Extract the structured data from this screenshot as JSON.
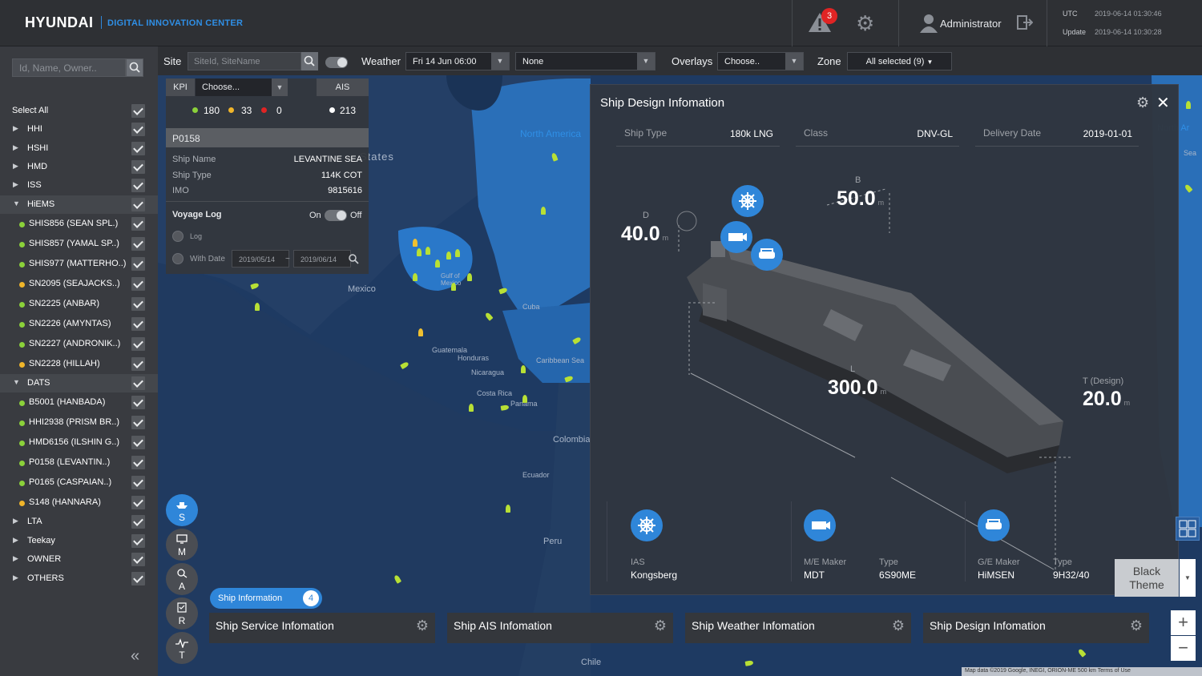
{
  "header": {
    "brand": "HYUNDAI",
    "subtitle": "DIGITAL INNOVATION CENTER",
    "alert_count": "3",
    "user": "Administrator",
    "utc_label": "UTC",
    "utc_value": "2019-06-14 01:30:46",
    "update_label": "Update",
    "update_value": "2019-06-14 10:30:28"
  },
  "sidebar": {
    "search_placeholder": "Id, Name, Owner..",
    "select_all": "Select All",
    "groups": [
      {
        "label": "HHI",
        "expanded": false
      },
      {
        "label": "HSHI",
        "expanded": false
      },
      {
        "label": "HMD",
        "expanded": false
      },
      {
        "label": "ISS",
        "expanded": false
      },
      {
        "label": "HiEMS",
        "expanded": true
      }
    ],
    "hiems_items": [
      {
        "label": "SHIS856 (SEAN SPL.)",
        "status": "green"
      },
      {
        "label": "SHIS857 (YAMAL SP..)",
        "status": "green"
      },
      {
        "label": "SHIS977 (MATTERHO..)",
        "status": "green"
      },
      {
        "label": "SN2095 (SEAJACKS..)",
        "status": "yellow"
      },
      {
        "label": "SN2225 (ANBAR)",
        "status": "green"
      },
      {
        "label": "SN2226 (AMYNTAS)",
        "status": "green"
      },
      {
        "label": "SN2227 (ANDRONIK..)",
        "status": "green"
      },
      {
        "label": "SN2228 (HILLAH)",
        "status": "yellow"
      }
    ],
    "dats_label": "DATS",
    "dats_items": [
      {
        "label": "B5001 (HANBADA)",
        "status": "green"
      },
      {
        "label": "HHI2938 (PRISM BR..)",
        "status": "green"
      },
      {
        "label": "HMD6156 (ILSHIN G..)",
        "status": "green"
      },
      {
        "label": "P0158 (LEVANTIN..)",
        "status": "green"
      },
      {
        "label": "P0165 (CASPAIAN..)",
        "status": "green"
      },
      {
        "label": "S148 (HANNARA)",
        "status": "yellow"
      }
    ],
    "tail_groups": [
      "LTA",
      "Teekay",
      "OWNER",
      "OTHERS"
    ]
  },
  "toolbar": {
    "site_label": "Site",
    "site_placeholder": "SiteId, SiteName",
    "weather_label": "Weather",
    "weather_value": "Fri 14 Jun 06:00",
    "weather_layer": "None",
    "overlays_label": "Overlays",
    "overlays_value": "Choose..",
    "zone_label": "Zone",
    "zone_value": "All selected (9)"
  },
  "kpi": {
    "label": "KPI",
    "choose": "Choose...",
    "ais_label": "AIS",
    "green": "180",
    "yellow": "33",
    "red": "0",
    "ais_count": "213"
  },
  "ship": {
    "id": "P0158",
    "name_k": "Ship Name",
    "name_v": "LEVANTINE SEA",
    "type_k": "Ship Type",
    "type_v": "114K COT",
    "imo_k": "IMO",
    "imo_v": "9815616",
    "voyage_log": "Voyage Log",
    "on": "On",
    "off": "Off",
    "log": "Log",
    "with_date": "With Date",
    "date_from": "2019/05/14",
    "date_to": "2019/06/14",
    "date_sep": "~"
  },
  "rail": [
    {
      "letter": "S",
      "active": true
    },
    {
      "letter": "M",
      "active": false
    },
    {
      "letter": "A",
      "active": false
    },
    {
      "letter": "R",
      "active": false
    },
    {
      "letter": "T",
      "active": false
    }
  ],
  "ship_info_pill": {
    "label": "Ship Information",
    "count": "4"
  },
  "cards": [
    "Ship Service Infomation",
    "Ship AIS Infomation",
    "Ship Weather Infomation",
    "Ship Design Infomation"
  ],
  "design": {
    "title": "Ship Design Infomation",
    "ship_type_k": "Ship Type",
    "ship_type_v": "180k LNG",
    "class_k": "Class",
    "class_v": "DNV-GL",
    "delivery_k": "Delivery Date",
    "delivery_v": "2019-01-01",
    "B_label": "B",
    "B_value": "50.0",
    "D_label": "D",
    "D_value": "40.0",
    "L_label": "L",
    "L_value": "300.0",
    "T_label": "T (Design)",
    "T_value": "20.0",
    "unit": "m",
    "ias_k": "IAS",
    "ias_v": "Kongsberg",
    "me_k": "M/E Maker",
    "me_v": "MDT",
    "me_type_k": "Type",
    "me_type_v": "6S90ME",
    "ge_k": "G/E Maker",
    "ge_v": "HiMSEN",
    "ge_type_k": "Type",
    "ge_type_v": "9H32/40"
  },
  "theme_button": "Black Theme",
  "map": {
    "labels": [
      "States",
      "North America",
      "Mexico",
      "Gulf of Mexico",
      "Cuba",
      "Guatemala",
      "Honduras",
      "Nicaragua",
      "Caribbean Sea",
      "Costa Rica",
      "Panama",
      "Colombia",
      "Ecuador",
      "Peru",
      "Chile",
      "Sea",
      "North Ar"
    ],
    "attribution": "Map data ©2019 Google, INEGI, ORION-ME   500 km    Terms of Use"
  },
  "colors": {
    "accent": "#2f86d9",
    "green": "#8bd13a",
    "yellow": "#f0b52a",
    "red": "#e02424"
  }
}
